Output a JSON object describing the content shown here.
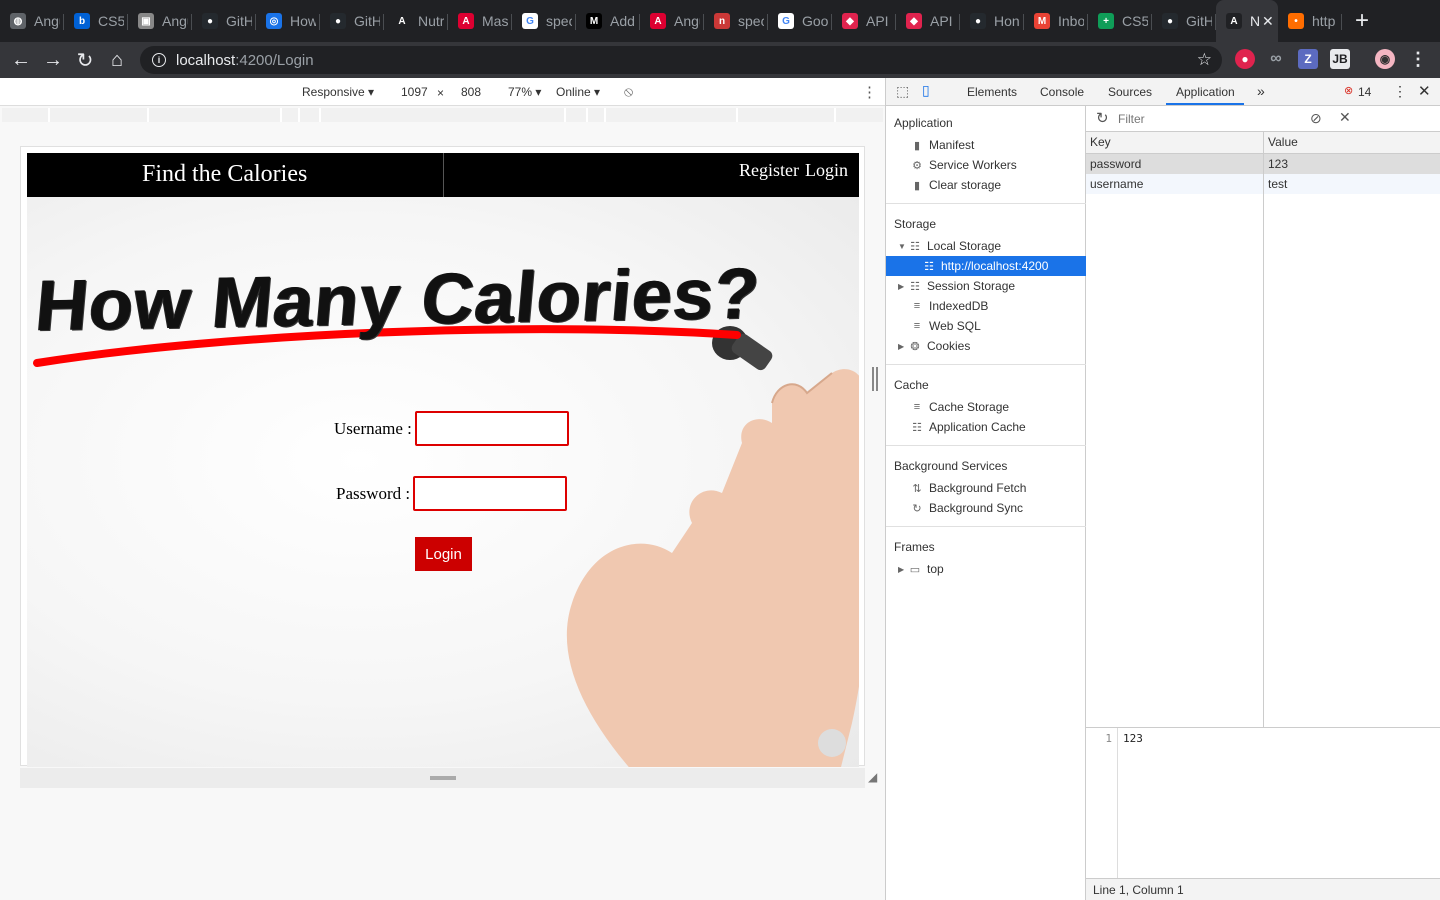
{
  "browser": {
    "tabs": [
      {
        "label": "Angu",
        "icon": "globe-icon",
        "color": "#5f6368"
      },
      {
        "label": "CS5",
        "icon": "box-icon",
        "color": "#0061d5"
      },
      {
        "label": "Angu",
        "icon": "image-icon",
        "color": "#888888"
      },
      {
        "label": "GitH",
        "icon": "github-icon",
        "color": "#24292e"
      },
      {
        "label": "How",
        "icon": "stackshare-icon",
        "color": "#1a73e8"
      },
      {
        "label": "GitH",
        "icon": "github-icon",
        "color": "#24292e"
      },
      {
        "label": "Nutr",
        "icon": "angular-a-icon",
        "color": "#202124"
      },
      {
        "label": "Mas",
        "icon": "angular-icon",
        "color": "#dd0031"
      },
      {
        "label": "spec",
        "icon": "google-icon",
        "color": "#ffffff"
      },
      {
        "label": "Add",
        "icon": "medium-icon",
        "color": "#000000"
      },
      {
        "label": "Angu",
        "icon": "angular-icon",
        "color": "#dd0031"
      },
      {
        "label": "spec",
        "icon": "npm-icon",
        "color": "#cb3837"
      },
      {
        "label": "Goo",
        "icon": "google-icon",
        "color": "#ffffff"
      },
      {
        "label": "API",
        "icon": "nest-icon",
        "color": "#e0234e"
      },
      {
        "label": "API",
        "icon": "nest-icon",
        "color": "#e0234e"
      },
      {
        "label": "Hon",
        "icon": "github-icon",
        "color": "#24292e"
      },
      {
        "label": "Inbo",
        "icon": "gmail-icon",
        "color": "#ea4335"
      },
      {
        "label": "CS5",
        "icon": "sheets-icon",
        "color": "#0f9d58"
      },
      {
        "label": "GitH",
        "icon": "github-icon",
        "color": "#24292e"
      },
      {
        "label": "N",
        "icon": "angular-a-icon",
        "color": "#202124",
        "active": true
      },
      {
        "label": "http",
        "icon": "dots-icon",
        "color": "#ff6d00"
      }
    ],
    "url_host": "localhost",
    "url_path": ":4200/Login"
  },
  "device_toolbar": {
    "mode": "Responsive ▾",
    "width": "1097",
    "times": "×",
    "height": "808",
    "zoom": "77% ▾",
    "network": "Online ▾"
  },
  "site": {
    "brand": "Find the Calories",
    "nav_register": "Register",
    "nav_login": "Login",
    "headline": "How Many Calories?",
    "username_label": "Username :",
    "password_label": "Password :",
    "login_button": "Login"
  },
  "devtools": {
    "tabs": [
      "Elements",
      "Console",
      "Sources",
      "Application"
    ],
    "active_tab": "Application",
    "more": "»",
    "error_count": "14",
    "sections": {
      "application": "Application",
      "storage": "Storage",
      "cache": "Cache",
      "background": "Background Services",
      "frames": "Frames"
    },
    "application_items": [
      "Manifest",
      "Service Workers",
      "Clear storage"
    ],
    "storage_items": [
      "Local Storage",
      "http://localhost:4200",
      "Session Storage",
      "IndexedDB",
      "Web SQL",
      "Cookies"
    ],
    "cache_items": [
      "Cache Storage",
      "Application Cache"
    ],
    "background_items": [
      "Background Fetch",
      "Background Sync"
    ],
    "frames_items": [
      "top"
    ],
    "filter_placeholder": "Filter",
    "table": {
      "headers": [
        "Key",
        "Value"
      ],
      "rows": [
        {
          "key": "password",
          "value": "123"
        },
        {
          "key": "username",
          "value": "test"
        }
      ]
    },
    "preview_line_no": "1",
    "preview_value": "123",
    "status": "Line 1, Column 1"
  }
}
